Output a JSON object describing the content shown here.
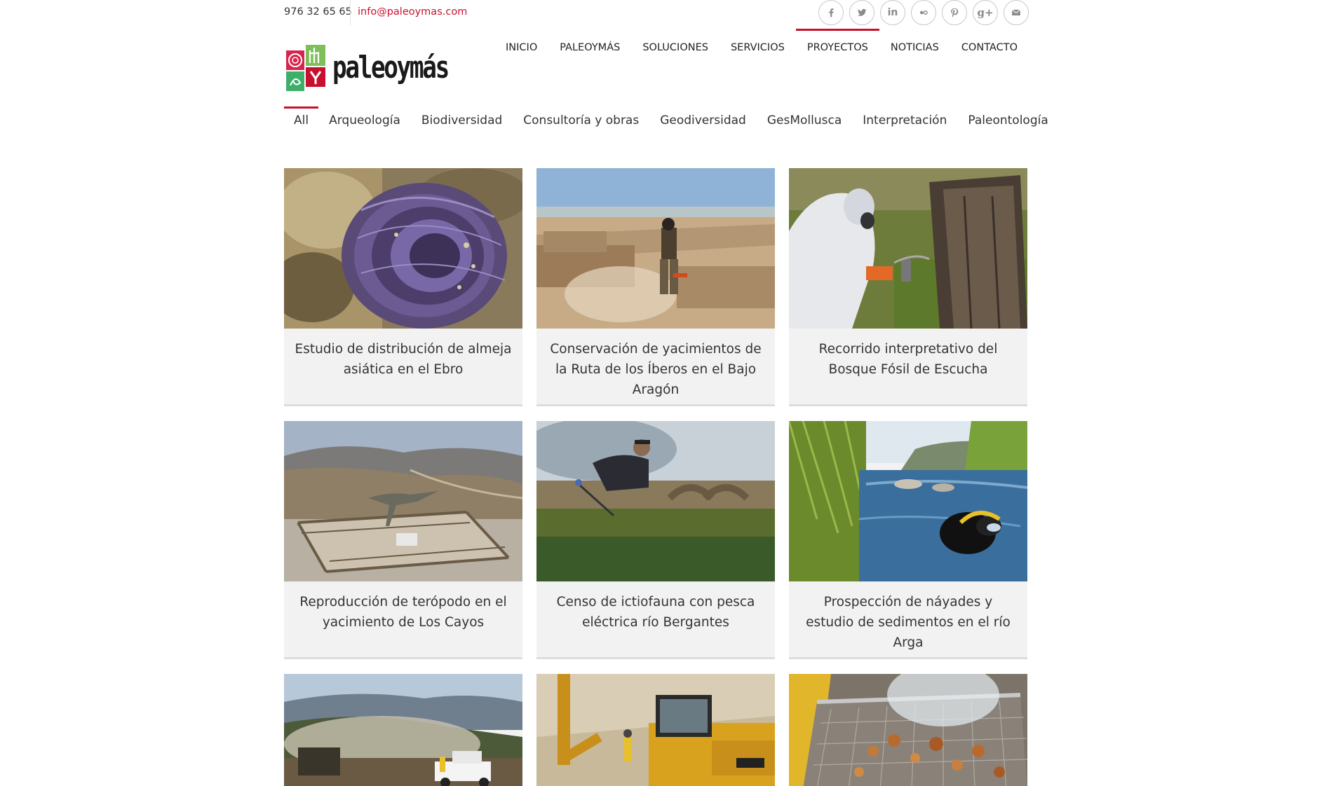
{
  "topbar": {
    "phone": "976 32 65 65",
    "email": "info@paleoymas.com",
    "socials": [
      {
        "name": "facebook-icon",
        "glyph": "f"
      },
      {
        "name": "twitter-icon",
        "glyph": ""
      },
      {
        "name": "linkedin-icon",
        "glyph": "in"
      },
      {
        "name": "flickr-icon",
        "glyph": "••"
      },
      {
        "name": "pinterest-icon",
        "glyph": "P"
      },
      {
        "name": "google-plus-icon",
        "glyph": "g+"
      },
      {
        "name": "mail-icon",
        "glyph": ""
      }
    ]
  },
  "header": {
    "logo_text": "paleoymás",
    "nav": [
      "INICIO",
      "PALEOYMÁS",
      "SOLUCIONES",
      "SERVICIOS",
      "PROYECTOS",
      "NOTICIAS",
      "CONTACTO"
    ],
    "active_nav": "PROYECTOS"
  },
  "filters": {
    "items": [
      "All",
      "Arqueología",
      "Biodiversidad",
      "Consultoría y obras",
      "Geodiversidad",
      "GesMollusca",
      "Interpretación",
      "Paleontología"
    ],
    "active": "All"
  },
  "colors": {
    "accent": "#c8102e",
    "card_bg": "#f2f2f2"
  },
  "projects": [
    {
      "title": "Estudio de distribución de almeja asiática en el Ebro",
      "image": "asian-clam-shell-photo"
    },
    {
      "title": "Conservación de yacimientos de la Ruta de los Íberos en el Bajo Aragón",
      "image": "site-worker-leaf-blower-photo"
    },
    {
      "title": "Recorrido interpretativo del Bosque Fósil de Escucha",
      "image": "worker-spraying-fossil-trunk-photo"
    },
    {
      "title": "Reproducción de terópodo en el yacimiento de Los Cayos",
      "image": "theropod-replica-enclosure-photo"
    },
    {
      "title": "Censo de ictiofauna con pesca eléctrica río Bergantes",
      "image": "electrofishing-river-photo"
    },
    {
      "title": "Prospección de náyades y estudio de sedimentos en el río Arga",
      "image": "diver-in-river-photo"
    },
    {
      "title": "",
      "image": "bulldozer-dust-road-photo"
    },
    {
      "title": "",
      "image": "excavator-case-photo"
    },
    {
      "title": "",
      "image": "sieve-gravel-photo"
    }
  ]
}
